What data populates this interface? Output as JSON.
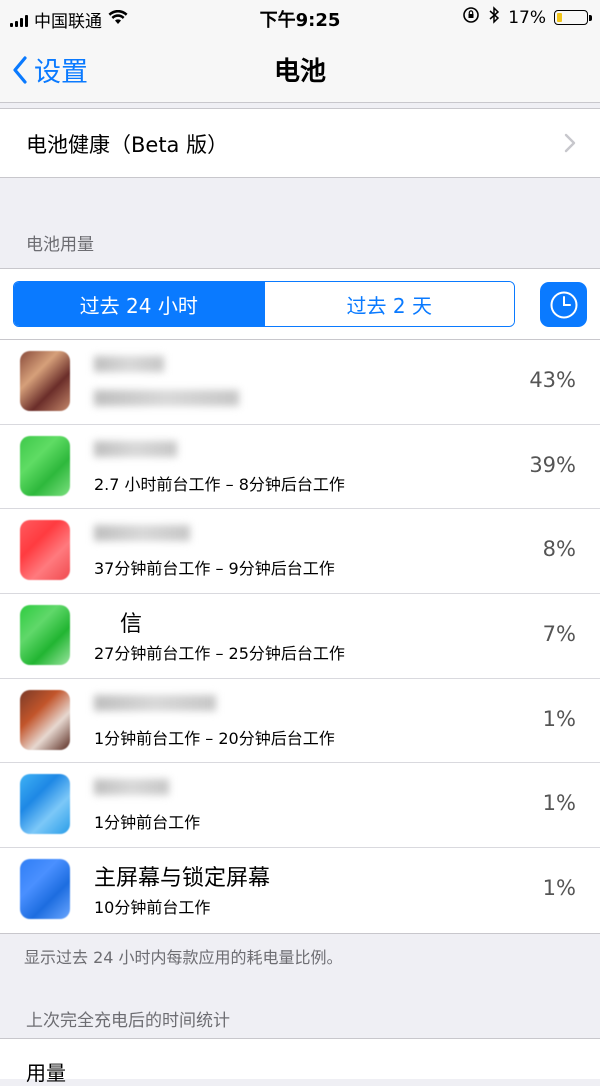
{
  "status_bar": {
    "carrier": "中国联通",
    "time": "下午9:25",
    "battery_percent": "17%",
    "battery_level": 0.17,
    "battery_color": "#f0c419"
  },
  "nav": {
    "back_label": "设置",
    "title": "电池"
  },
  "health_cell": {
    "label": "电池健康（Beta 版）"
  },
  "usage_section": {
    "header": "电池用量",
    "segments": [
      "过去 24 小时",
      "过去 2 天"
    ],
    "selected_segment": 0,
    "clock_icon": "clock-icon"
  },
  "apps": [
    {
      "name": "",
      "detail": "",
      "percent": "43%",
      "icon_colors": [
        "#8a4b3b",
        "#d6a07a",
        "#6b2e2a",
        "#c4876a"
      ]
    },
    {
      "name": "",
      "detail": "2.7 小时前台工作 – 8分钟后台工作",
      "percent": "39%",
      "icon_colors": [
        "#3ec94a",
        "#5fdc64",
        "#2eb83c",
        "#7be07f"
      ]
    },
    {
      "name": "",
      "detail": "37分钟前台工作 – 9分钟后台工作",
      "percent": "8%",
      "icon_colors": [
        "#ff5a5f",
        "#ff3b40",
        "#ff7a7e",
        "#f04a4f"
      ]
    },
    {
      "name": "信",
      "detail": "27分钟前台工作 – 25分钟后台工作",
      "percent": "7%",
      "icon_colors": [
        "#2ecc40",
        "#60d86a",
        "#22b532",
        "#9ae59f"
      ]
    },
    {
      "name": "",
      "detail": "1分钟前台工作 – 20分钟后台工作",
      "percent": "1%",
      "icon_colors": [
        "#7a3a28",
        "#c2552b",
        "#e7d8d0",
        "#5a2c22"
      ]
    },
    {
      "name": "",
      "detail": "1分钟前台工作",
      "percent": "1%",
      "icon_colors": [
        "#3fb2f5",
        "#1e88e5",
        "#7cc8f8",
        "#2a9de8"
      ]
    },
    {
      "name": "主屏幕与锁定屏幕",
      "detail": "10分钟前台工作",
      "percent": "1%",
      "icon_colors": [
        "#2f7ef5",
        "#4a90ff",
        "#1d6de0",
        "#6aa6ff"
      ]
    }
  ],
  "footer_note": "显示过去 24 小时内每款应用的耗电量比例。",
  "stats_section_header": "上次完全充电后的时间统计",
  "bottom_cell_label": "用量"
}
